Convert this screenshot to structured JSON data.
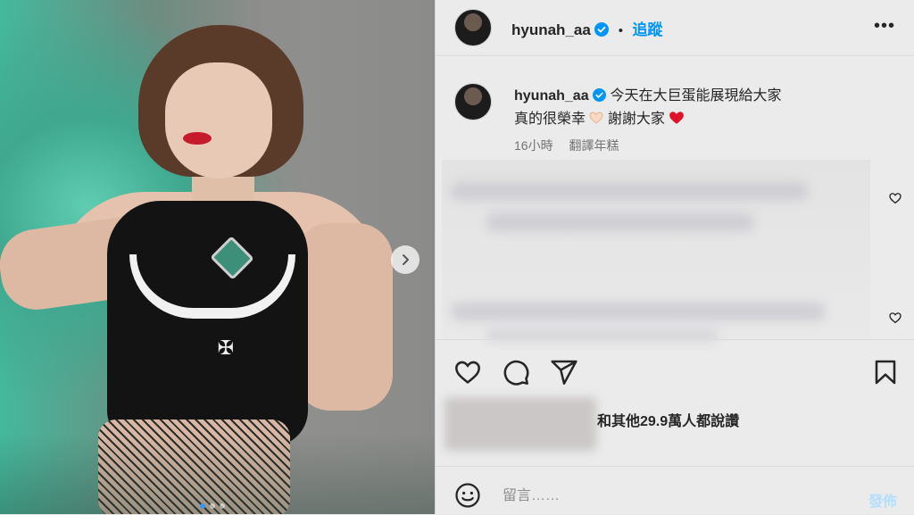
{
  "post": {
    "username": "hyunah_aa",
    "follow_label": "追蹤",
    "more_label": "•••",
    "separator": "•",
    "caption_line1": "今天在大巨蛋能展現給大家",
    "caption_line2_a": "真的很榮幸",
    "caption_line2_b": "謝謝大家",
    "time_ago": "16小時",
    "translate_label": "翻譯年糕",
    "likes_text": "和其他29.9萬人都說讚",
    "comment_placeholder": "留言……",
    "post_label": "發佈",
    "carousel": {
      "total": 3,
      "active": 1
    }
  },
  "icons": {
    "verified": "verified-badge-icon",
    "next": "chevron-right-icon",
    "heart": "heart-icon",
    "comment": "comment-bubble-icon",
    "share": "paper-plane-icon",
    "save": "bookmark-icon",
    "emoji": "smiley-icon",
    "hands_heart": "heart-hands-emoji",
    "red_heart": "red-heart-emoji"
  },
  "colors": {
    "accent": "#0095f6",
    "panel_bg": "#ebebeb",
    "muted_text": "#737373",
    "post_disabled": "#b2dffc"
  }
}
